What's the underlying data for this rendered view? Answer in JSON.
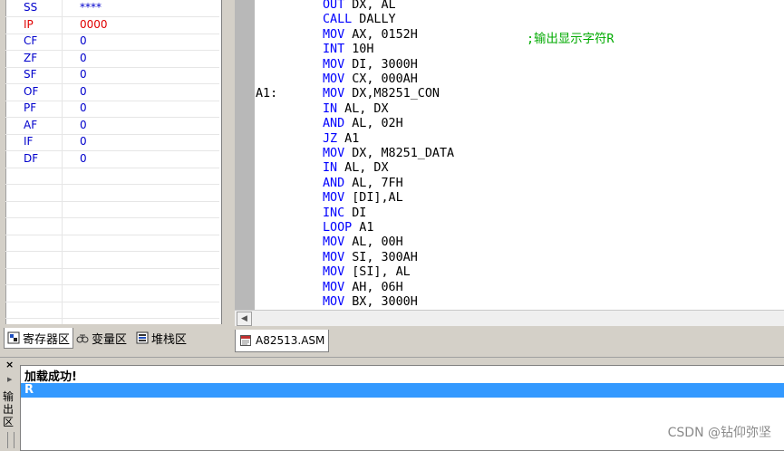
{
  "registers": [
    {
      "name": "SS",
      "value": "****",
      "highlight": false
    },
    {
      "name": "IP",
      "value": "0000",
      "highlight": true
    },
    {
      "name": "CF",
      "value": "0",
      "highlight": false
    },
    {
      "name": "ZF",
      "value": "0",
      "highlight": false
    },
    {
      "name": "SF",
      "value": "0",
      "highlight": false
    },
    {
      "name": "OF",
      "value": "0",
      "highlight": false
    },
    {
      "name": "PF",
      "value": "0",
      "highlight": false
    },
    {
      "name": "AF",
      "value": "0",
      "highlight": false
    },
    {
      "name": "IF",
      "value": "0",
      "highlight": false
    },
    {
      "name": "DF",
      "value": "0",
      "highlight": false
    }
  ],
  "left_tabs": [
    {
      "label": "寄存器区",
      "icon": "register-icon",
      "active": true
    },
    {
      "label": "变量区",
      "icon": "variable-icon",
      "active": false
    },
    {
      "label": "堆栈区",
      "icon": "stack-icon",
      "active": false
    }
  ],
  "code": [
    {
      "label": "",
      "kw": "OUT",
      "ops": " DX, AL",
      "comment": ""
    },
    {
      "label": "",
      "kw": "CALL",
      "ops": " DALLY",
      "comment": ""
    },
    {
      "label": "",
      "kw": "MOV",
      "ops": " AX, 0152H",
      "comment": ";输出显示字符R"
    },
    {
      "label": "",
      "kw": "INT",
      "ops": " 10H",
      "comment": ""
    },
    {
      "label": "",
      "kw": "MOV",
      "ops": " DI, 3000H",
      "comment": ""
    },
    {
      "label": "",
      "kw": "MOV",
      "ops": " CX, 000AH",
      "comment": ""
    },
    {
      "label": "A1:",
      "kw": "MOV",
      "ops": " DX,M8251_CON",
      "comment": ""
    },
    {
      "label": "",
      "kw": "IN",
      "ops": " AL, DX",
      "comment": ""
    },
    {
      "label": "",
      "kw": "AND",
      "ops": " AL, 02H",
      "comment": ""
    },
    {
      "label": "",
      "kw": "JZ",
      "ops": " A1",
      "comment": ""
    },
    {
      "label": "",
      "kw": "MOV",
      "ops": " DX, M8251_DATA",
      "comment": ""
    },
    {
      "label": "",
      "kw": "IN",
      "ops": " AL, DX",
      "comment": ""
    },
    {
      "label": "",
      "kw": "AND",
      "ops": " AL, 7FH",
      "comment": ""
    },
    {
      "label": "",
      "kw": "MOV",
      "ops": " [DI],AL",
      "comment": ""
    },
    {
      "label": "",
      "kw": "INC",
      "ops": " DI",
      "comment": ""
    },
    {
      "label": "",
      "kw": "LOOP",
      "ops": " A1",
      "comment": ""
    },
    {
      "label": "",
      "kw": "MOV",
      "ops": " AL, 00H",
      "comment": ""
    },
    {
      "label": "",
      "kw": "MOV",
      "ops": " SI, 300AH",
      "comment": ""
    },
    {
      "label": "",
      "kw": "MOV",
      "ops": " [SI], AL",
      "comment": ""
    },
    {
      "label": "",
      "kw": "MOV",
      "ops": " AH, 06H",
      "comment": ""
    },
    {
      "label": "",
      "kw": "MOV",
      "ops": " BX, 3000H",
      "comment": ""
    }
  ],
  "file_tab": {
    "label": "A82513.ASM",
    "icon": "asm-file-icon"
  },
  "output_panel": {
    "close_glyph": "×",
    "side_label": "输出区",
    "lines": [
      {
        "text": "加载成功!",
        "selected": false
      },
      {
        "text": "R",
        "selected": true
      }
    ]
  },
  "watermark": "CSDN @钻仰弥坚",
  "colors": {
    "register_name": "#0000cc",
    "register_highlight": "#e00000",
    "keyword": "#0000ff",
    "comment": "#00aa00",
    "selection": "#3399ff"
  }
}
